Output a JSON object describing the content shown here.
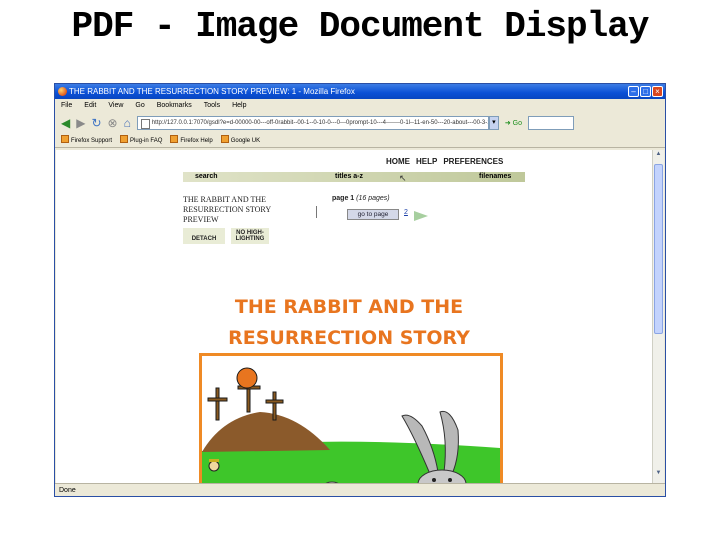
{
  "slide": {
    "title": "PDF - Image Document Display"
  },
  "browser": {
    "title": "THE RABBIT AND THE RESURRECTION STORY PREVIEW: 1 - Mozilla Firefox",
    "menu": [
      "File",
      "Edit",
      "View",
      "Go",
      "Bookmarks",
      "Tools",
      "Help"
    ],
    "url": "http://127.0.0.1:7070/gsdl?e=d-00000-00---off-0rabbit--00-1--0-10-0---0---0prompt-10---4-------0-1l--11-en-50---20-about---00-3-1-00-0-0-11-1-0utfZz-8-00&a=d&c=rabbit",
    "go_label": "Go",
    "bookmarks": [
      "Firefox Support",
      "Plug-in FAQ",
      "Firefox Help",
      "Google UK"
    ],
    "status": "Done"
  },
  "page": {
    "nav": [
      "HOME",
      "HELP",
      "PREFERENCES"
    ],
    "search_label": "search",
    "titles_label": "titles a-z",
    "filenames_label": "filenames",
    "doc_title": "THE RABBIT AND THE RESURRECTION STORY PREVIEW",
    "detach_label": "DETACH",
    "no_highlighting_label": "NO HIGH-LIGHTING",
    "page_label": "page 1",
    "page_count": "(16 pages)",
    "goto_label": "go to page",
    "next_page": "2",
    "story_title": "THE RABBIT AND THE RESURRECTION STORY"
  }
}
